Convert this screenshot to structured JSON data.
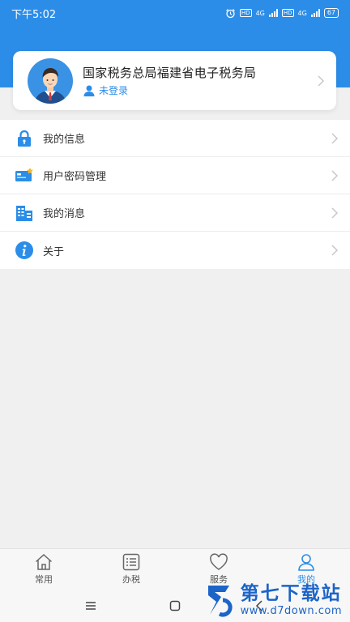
{
  "status_bar": {
    "time": "下午5:02",
    "battery": "67",
    "net1": "4G",
    "net2": "4G",
    "hd1": "HD",
    "hd2": "HD"
  },
  "profile": {
    "bureau": "国家税务总局福建省电子税务局",
    "login_status": "未登录"
  },
  "menu": {
    "items": [
      {
        "label": "我的信息",
        "icon": "lock-icon"
      },
      {
        "label": "用户密码管理",
        "icon": "password-card-icon"
      },
      {
        "label": "我的消息",
        "icon": "message-building-icon"
      },
      {
        "label": "关于",
        "icon": "info-icon"
      }
    ]
  },
  "tabbar": {
    "tabs": [
      {
        "label": "常用",
        "icon": "home-icon"
      },
      {
        "label": "办税",
        "icon": "list-icon"
      },
      {
        "label": "服务",
        "icon": "heart-icon"
      },
      {
        "label": "我的",
        "icon": "user-icon",
        "active": true
      }
    ]
  },
  "watermark": {
    "title": "第七下载站",
    "subtitle": "www.d7down.com"
  },
  "colors": {
    "accent": "#2b8de8",
    "background": "#f0f0f0"
  }
}
